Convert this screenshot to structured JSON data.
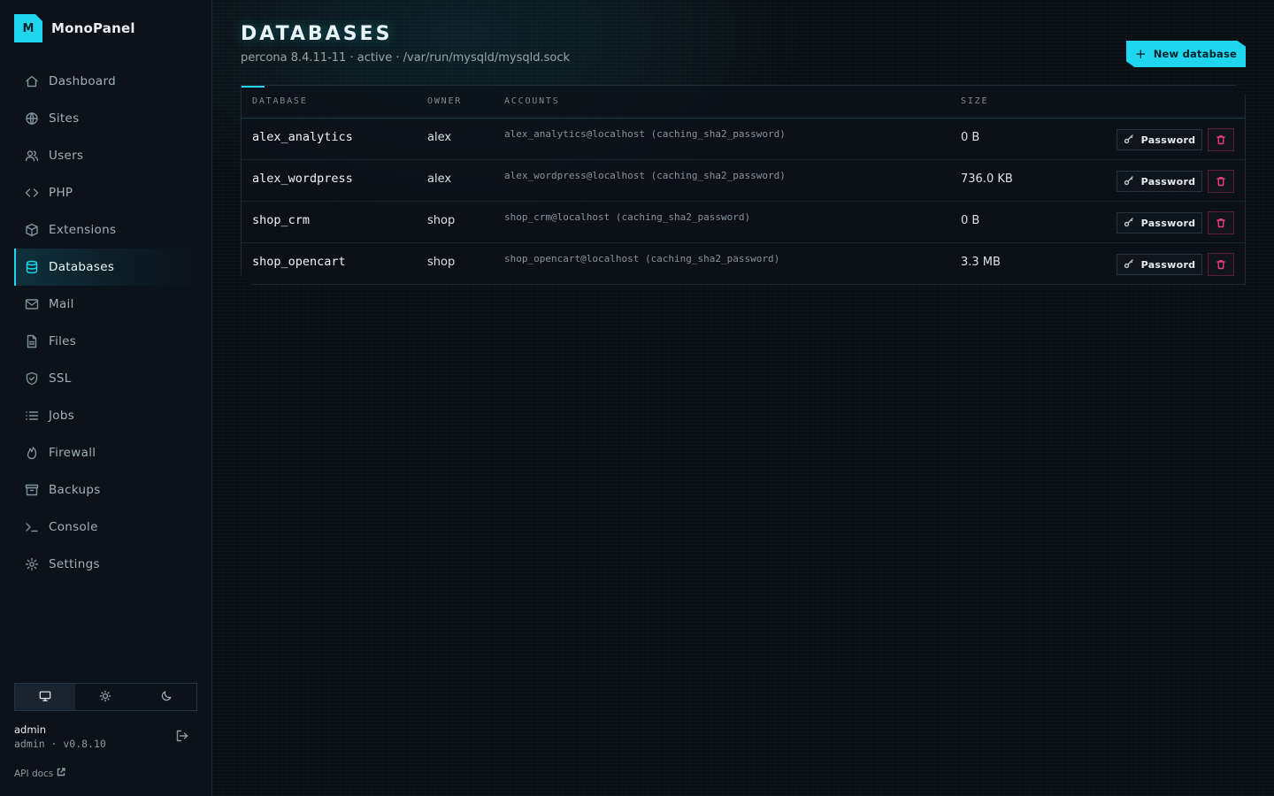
{
  "brand": {
    "logo_letter": "M",
    "name": "MonoPanel",
    "accent": "#1fd6ee"
  },
  "sidebar": {
    "items": [
      {
        "label": "Dashboard",
        "icon": "home-icon"
      },
      {
        "label": "Sites",
        "icon": "globe-icon"
      },
      {
        "label": "Users",
        "icon": "users-icon"
      },
      {
        "label": "PHP",
        "icon": "code-icon"
      },
      {
        "label": "Extensions",
        "icon": "package-icon"
      },
      {
        "label": "Databases",
        "icon": "database-icon",
        "active": true
      },
      {
        "label": "Mail",
        "icon": "mail-icon"
      },
      {
        "label": "Files",
        "icon": "file-icon"
      },
      {
        "label": "SSL",
        "icon": "shield-icon"
      },
      {
        "label": "Jobs",
        "icon": "list-icon"
      },
      {
        "label": "Firewall",
        "icon": "flame-icon"
      },
      {
        "label": "Backups",
        "icon": "archive-icon"
      },
      {
        "label": "Console",
        "icon": "terminal-icon"
      },
      {
        "label": "Settings",
        "icon": "gear-icon"
      }
    ],
    "theme_options": [
      "monitor-icon",
      "sun-icon",
      "moon-icon"
    ],
    "theme_selected": "monitor-icon",
    "user": {
      "name": "admin",
      "meta": "admin · v0.8.10"
    },
    "api_docs_label": "API docs"
  },
  "page": {
    "title": "DATABASES",
    "subtitle": "percona 8.4.11-11 · active · /var/run/mysqld/mysqld.sock",
    "new_button_label": "New database"
  },
  "table": {
    "headers": {
      "database": "DATABASE",
      "owner": "OWNER",
      "accounts": "ACCOUNTS",
      "size": "SIZE"
    },
    "password_label": "Password",
    "rows": [
      {
        "database": "alex_analytics",
        "owner": "alex",
        "accounts": "alex_analytics@localhost (caching_sha2_password)",
        "size": "0 B"
      },
      {
        "database": "alex_wordpress",
        "owner": "alex",
        "accounts": "alex_wordpress@localhost (caching_sha2_password)",
        "size": "736.0 KB"
      },
      {
        "database": "shop_crm",
        "owner": "shop",
        "accounts": "shop_crm@localhost (caching_sha2_password)",
        "size": "0 B"
      },
      {
        "database": "shop_opencart",
        "owner": "shop",
        "accounts": "shop_opencart@localhost (caching_sha2_password)",
        "size": "3.3 MB"
      }
    ]
  }
}
